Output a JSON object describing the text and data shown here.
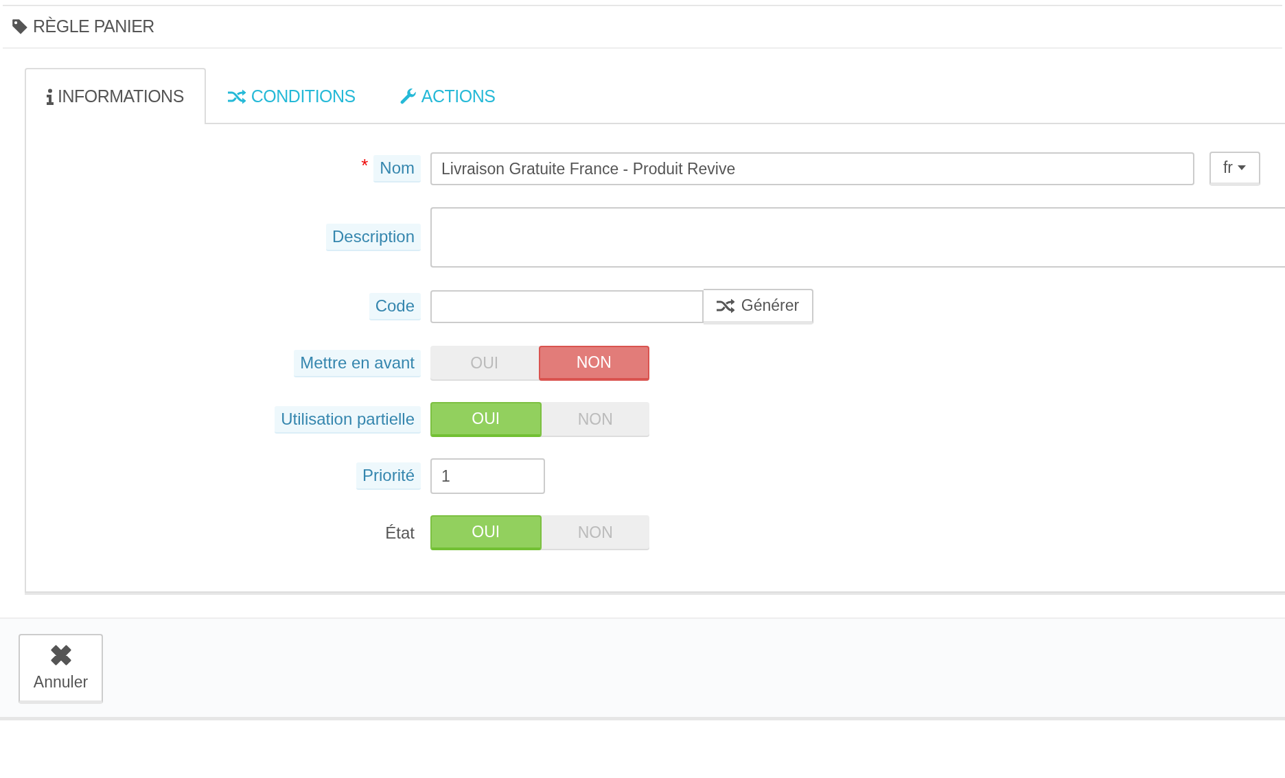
{
  "header": {
    "title": "RÈGLE PANIER"
  },
  "tabs": [
    {
      "label": "INFORMATIONS",
      "selected": true
    },
    {
      "label": "CONDITIONS",
      "selected": false
    },
    {
      "label": "ACTIONS",
      "selected": false
    }
  ],
  "fields": [
    {
      "kind": "text",
      "label": "Nom",
      "marker": "*",
      "help": true,
      "value": "Livraison Gratuite France - Produit Revive",
      "language": "fr"
    },
    {
      "kind": "textarea",
      "label": "Description",
      "help": true
    },
    {
      "kind": "code",
      "label": "Code",
      "help": true,
      "button": "Générer"
    },
    {
      "kind": "toggle",
      "label": "Mettre en avant",
      "help": true,
      "options": [
        {
          "label": "OUI",
          "selected": false
        },
        {
          "label": "NON",
          "selected": true
        }
      ]
    },
    {
      "kind": "toggle",
      "label": "Utilisation partielle",
      "help": true,
      "options": [
        {
          "label": "OUI",
          "selected": true
        },
        {
          "label": "NON",
          "selected": false
        }
      ]
    },
    {
      "kind": "number",
      "label": "Priorité",
      "help": true,
      "value": "1"
    },
    {
      "kind": "toggle",
      "label": "État",
      "help": false,
      "options": [
        {
          "label": "OUI",
          "selected": true
        },
        {
          "label": "NON",
          "selected": false
        }
      ]
    }
  ],
  "footer": {
    "buttons": [
      {
        "label": "Annuler"
      }
    ]
  }
}
